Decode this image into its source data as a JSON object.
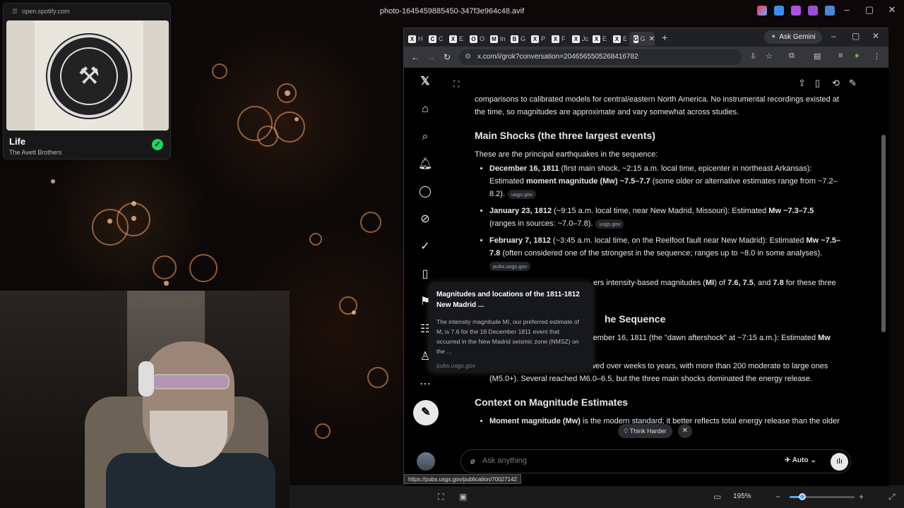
{
  "viewer": {
    "title": "photo-1645459885450-347f3e964c48.avif",
    "zoom": "195%",
    "zoom_fraction": 0.2
  },
  "spotify": {
    "url": "open.spotify.com",
    "track": "Life",
    "artist": "The Avett Brothers"
  },
  "browser": {
    "tabs": [
      "H",
      "C",
      "E",
      "O",
      "In",
      "G",
      "P",
      "F",
      "Jc",
      "E",
      "E",
      "G"
    ],
    "ask_gemini": "Ask Gemini",
    "url": "x.com/i/grok?conversation=2046565505268416782",
    "status_url": "https://pubs.usgs.gov/publication/70027142"
  },
  "grok": {
    "intro": "comparisons to calibrated models for central/eastern North America. No instrumental recordings existed at the time, so magnitudes are approximate and vary somewhat across studies.",
    "main_heading": "Main Shocks (the three largest events)",
    "main_lead": "These are the principal earthquakes in the sequence:",
    "shocks": [
      {
        "date": "December 16, 1811",
        "text": " (first main shock, ~2:15 a.m. local time, epicenter in northeast Arkansas): Estimated ",
        "bold2": "moment magnitude (Mw) ~7.5–7.7",
        "text2": " (some older or alternative estimates range from ~7.2–8.2).",
        "source": "usgs.gov"
      },
      {
        "date": "January 23, 1812",
        "text": " (~9:15 a.m. local time, near New Madrid, Missouri): Estimated ",
        "bold2": "Mw ~7.3–7.5",
        "text2": " (ranges in sources: ~7.0–7.8).",
        "source": "usgs.gov"
      },
      {
        "date": "February 7, 1812",
        "text": " (~3:45 a.m. local time, on the Reelfoot fault near New Madrid): Estimated ",
        "bold2": "Mw ~7.5–7.8",
        "text2": " (often considered one of the strongest in the sequence; ranges up to ~8.0 in some analyses).",
        "source": "pubs.usgs.gov"
      }
    ],
    "partial_line": "ers intensity-based magnitudes (",
    "partial_mi": "MI",
    "partial_mid": ") of ",
    "partial_vals": "7.6, 7.5",
    "partial_and": ", and ",
    "partial_78": "7.8",
    "partial_end": " for these three",
    "after_heading": "he Sequence",
    "after_line1": "ecember 16, 1811 (the \"dawn aftershock\" at ~7:15 a.m.): Estimated ",
    "after_line1_bold": "Mw",
    "after_bullet": "Hundreds of aftershocks followed over weeks to years, with more than 200 moderate to large ones (M5.0+). Several reached M6.0–6.5, but the three main shocks dominated the energy release.",
    "context_heading": "Context on Magnitude Estimates",
    "context_bullet_bold": "Moment magnitude (Mw)",
    "context_bullet": " is the modern standard; it better reflects total energy release than the older",
    "think_harder": "Think Harder",
    "input_placeholder": "Ask anything",
    "mode": "Auto"
  },
  "popup": {
    "title": "Magnitudes and locations of the 1811-1812 New Madrid ...",
    "description": "The intensity magnitude MI, our preferred estimate of M, is 7.6 for the 16 December 1811 event that occurred in the New Madrid seismic zone (NMSZ) on the ...",
    "source": "pubs.usgs.gov"
  },
  "colors": {
    "accent_green": "#1ed760",
    "bokeh": "#ffa05a",
    "slider": "#5aa6e8"
  }
}
